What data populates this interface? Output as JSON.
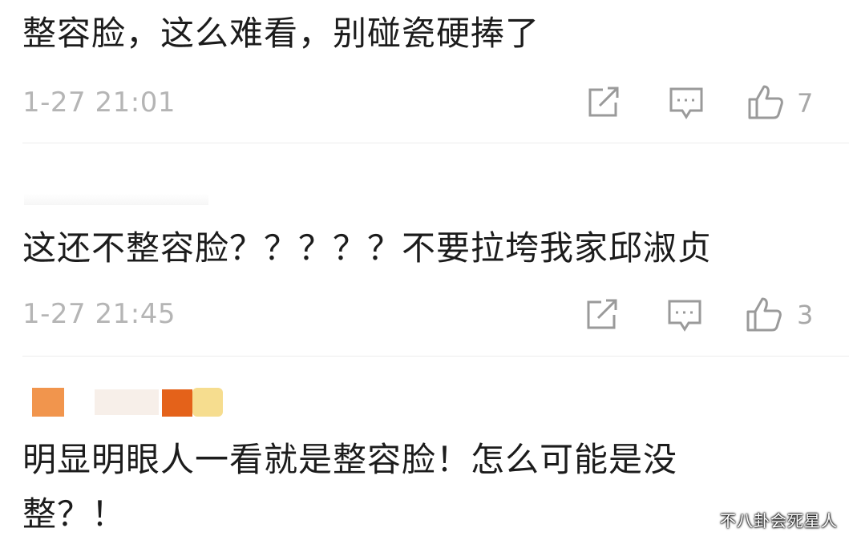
{
  "comments": [
    {
      "text": "整容脸，这么难看，别碰瓷硬捧了",
      "time": "1-27 21:01",
      "likes": "7",
      "actions": [
        "share-icon",
        "reply-icon",
        "thumbs-up-icon"
      ]
    },
    {
      "text": "这还不整容脸？？？？？不要拉垮我家邱淑贞",
      "time": "1-27 21:45",
      "likes": "3",
      "actions": [
        "share-icon",
        "reply-icon",
        "thumbs-up-icon"
      ]
    },
    {
      "text_line1": "明显明眼人一看就是整容脸！怎么可能是没",
      "text_line2": "整？！"
    }
  ],
  "watermark": "不八卦会死星人",
  "colors": {
    "text": "#1c1c1c",
    "meta": "#b5b5b5",
    "icon": "#9a9a9a",
    "badge_orange": "#ef8a3a",
    "badge_dark_orange": "#e4621a",
    "badge_yellow": "#f6dd8f"
  }
}
